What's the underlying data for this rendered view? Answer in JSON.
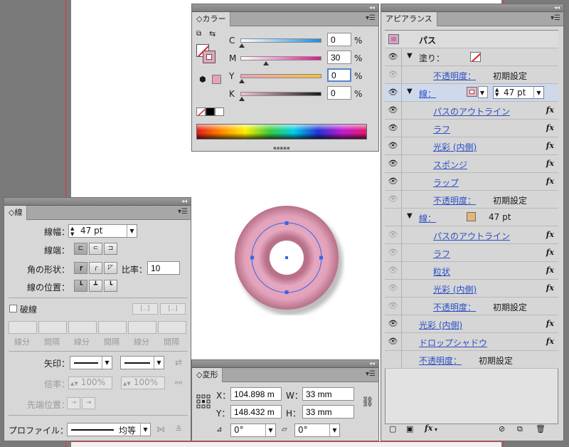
{
  "colors": {
    "accent": "#2b4fc4",
    "guide": "#e0353b",
    "artwork": "#e6a6bc",
    "path": "#3a62e6"
  },
  "color_panel": {
    "title": "カラー",
    "rows": [
      {
        "label": "C",
        "value": "0",
        "unit": "%",
        "level": 0.0
      },
      {
        "label": "M",
        "value": "30",
        "unit": "%",
        "level": 0.3
      },
      {
        "label": "Y",
        "value": "0",
        "unit": "%",
        "level": 0.0
      },
      {
        "label": "K",
        "value": "0",
        "unit": "%",
        "level": 0.0
      }
    ]
  },
  "stroke_panel": {
    "title": "線",
    "weight_label": "線幅：",
    "weight_value": "47 pt",
    "cap_label": "線端：",
    "corner_label": "角の形状：",
    "miter_label": "比率：",
    "miter_value": "10",
    "align_label": "線の位置：",
    "dashed_label": "破線",
    "dash_labels": [
      "線分",
      "間隔",
      "線分",
      "間隔",
      "線分",
      "間隔"
    ],
    "arrow_label": "矢印：",
    "scale_label": "倍率：",
    "scale_value_1": "100%",
    "scale_value_2": "100%",
    "tip_label": "先端位置：",
    "profile_label": "プロファイル：",
    "profile_value": "均等"
  },
  "transform_panel": {
    "title": "変形",
    "x_label": "X：",
    "x_value": "104.898 m",
    "y_label": "Y：",
    "y_value": "148.432 m",
    "w_label": "W：",
    "w_value": "33 mm",
    "h_label": "H：",
    "h_value": "33 mm",
    "rotate_value": "0°",
    "shear_value": "0°"
  },
  "appearance_panel": {
    "title": "アピアランス",
    "header_label": "パス",
    "rows": [
      {
        "label": "塗り：",
        "type": "fill"
      },
      {
        "label": "不透明度：",
        "value": "初期設定",
        "indent": true
      },
      {
        "label": "線：",
        "value": "47 pt",
        "selected": true
      },
      {
        "label": "パスのアウトライン",
        "fx": "fx",
        "indent": true
      },
      {
        "label": "ラフ",
        "fx": "fx",
        "indent": true
      },
      {
        "label": "光彩 (内側)",
        "fx": "fx",
        "indent": true
      },
      {
        "label": "スポンジ",
        "fx": "fx",
        "indent": true
      },
      {
        "label": "ラップ",
        "fx": "fx",
        "indent": true
      },
      {
        "label": "不透明度：",
        "value": "初期設定",
        "indent": true
      },
      {
        "label": "線：",
        "value": "47 pt"
      },
      {
        "label": "パスのアウトライン",
        "fx": "fx",
        "indent": true
      },
      {
        "label": "ラフ",
        "fx": "fx",
        "indent": true
      },
      {
        "label": "粒状",
        "fx": "fx",
        "indent": true
      },
      {
        "label": "光彩 (内側)",
        "fx": "fx",
        "indent": true
      },
      {
        "label": "不透明度：",
        "value": "初期設定",
        "indent": true
      },
      {
        "label": "光彩 (内側)",
        "fx": "fx"
      },
      {
        "label": "ドロップシャドウ",
        "fx": "fx"
      },
      {
        "label": "不透明度：",
        "value": "初期設定"
      }
    ],
    "footer_fx": "fx"
  }
}
